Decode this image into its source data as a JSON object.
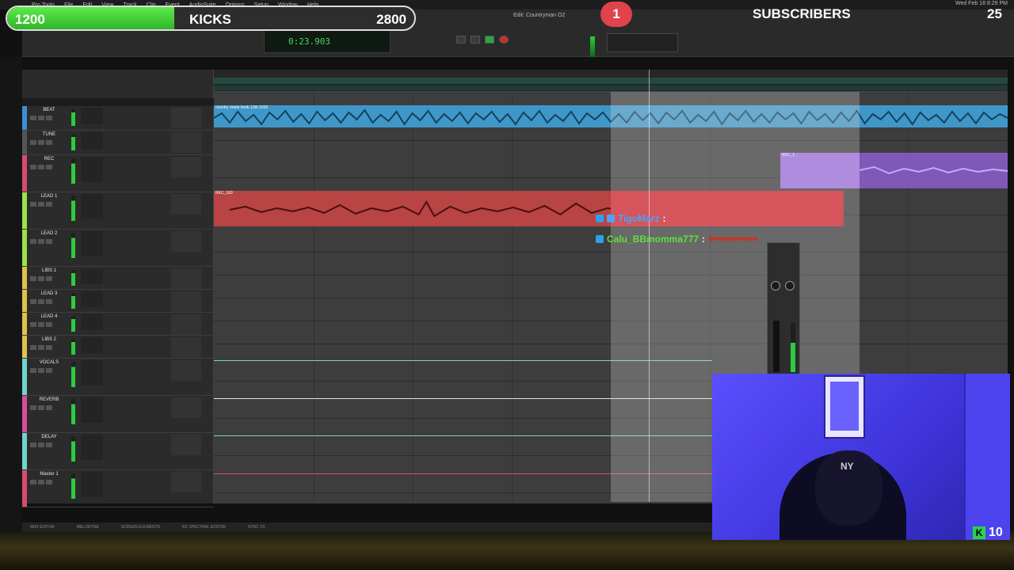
{
  "overlay": {
    "goal_start": "1200",
    "goal_label": "KICKS",
    "goal_target": "2800",
    "goal_progress": 0.41,
    "sub_badge_count": "1",
    "subscribers_label": "SUBSCRIBERS",
    "subscribers_count": "25",
    "kick_viewers": "10",
    "colors": {
      "goal_green": "#3fd137",
      "sub_red": "#e0434b",
      "kick_green": "#28d34a"
    }
  },
  "window": {
    "title": "Edit: Countryman O2"
  },
  "menubar": {
    "items": [
      "Pro Tools",
      "File",
      "Edit",
      "View",
      "Track",
      "Clip",
      "Event",
      "AudioSuite",
      "Options",
      "Setup",
      "Window",
      "Help"
    ],
    "clock": "Wed Feb 18 8:29 PM"
  },
  "counter": {
    "main": "0:23.903"
  },
  "tracks": [
    {
      "name": "BEAT",
      "color": "#3a8fd8"
    },
    {
      "name": "TUNE",
      "color": "#555555"
    },
    {
      "name": "REC",
      "color": "#d84c6c"
    },
    {
      "name": "LEAD 1",
      "color": "#9be24a"
    },
    {
      "name": "LEAD 2",
      "color": "#9be24a"
    },
    {
      "name": "LIBS 1",
      "color": "#e2c14a"
    },
    {
      "name": "LEAD 3",
      "color": "#e2c14a"
    },
    {
      "name": "LEAD 4",
      "color": "#e2c14a"
    },
    {
      "name": "LIBS 2",
      "color": "#e2c14a"
    },
    {
      "name": "VOCALS",
      "color": "#6ed4d0"
    },
    {
      "name": "REVERB",
      "color": "#d84c9c"
    },
    {
      "name": "DELAY",
      "color": "#6ed4d0"
    },
    {
      "name": "Master 1",
      "color": "#d84c6c"
    }
  ],
  "clips": {
    "beat_title": "country roads hook 12th 2026",
    "rec_title": "REC_1",
    "lead_title": "REC_160",
    "lead_db": "+ 0 dB"
  },
  "chat": [
    {
      "user": "TigoMarz",
      "sep": " :",
      "emotes": "",
      "color": "#4aa3ff"
    },
    {
      "user": "Calu_BBmomma777",
      "sep": " :",
      "emotes": "♥♥♥♥♥♥♥♥♥♥",
      "color": "#5fe03b"
    }
  ],
  "bottom_bar": {
    "items": [
      "MIDI EDITOR",
      "MELODYNE",
      "SCREEN ELEMENTS",
      "RX SPECTRAL EDITOR",
      "SYNC VX"
    ]
  }
}
